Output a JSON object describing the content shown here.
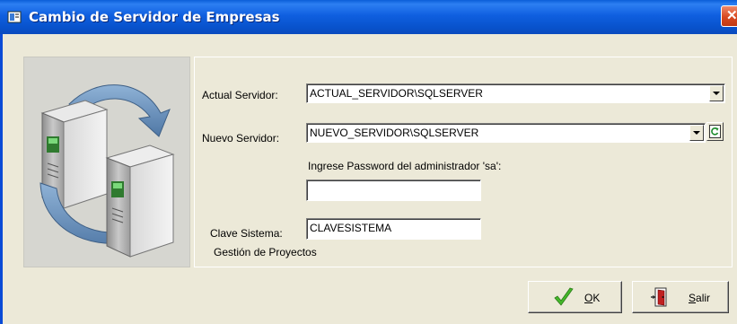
{
  "window": {
    "title": "Cambio de Servidor de Empresas",
    "close_glyph": "✕",
    "title_icon": "server-app-icon"
  },
  "form": {
    "current_server_label": "Actual Servidor:",
    "current_server_value": "ACTUAL_SERVIDOR\\SQLSERVER",
    "new_server_label": "Nuevo Servidor:",
    "new_server_value": "NUEVO_SERVIDOR\\SQLSERVER",
    "password_prompt": "Ingrese Password del administrador 'sa':",
    "password_value": "",
    "system_key_label": "Clave Sistema:",
    "system_key_value": "CLAVESISTEMA",
    "footer_caption": "Gestión de Proyectos"
  },
  "buttons": {
    "ok_label": "OK",
    "exit_label": "Salir"
  },
  "icons": {
    "illustration": "server-swap-illustration",
    "refresh": "refresh-icon",
    "ok": "checkmark-icon",
    "exit": "exit-door-icon"
  },
  "colors": {
    "titlebar": "#0a55d6",
    "window_bg": "#ece9d8",
    "close_button": "#d8481f",
    "checkmark": "#44b82a",
    "exit_door": "#c02020"
  }
}
